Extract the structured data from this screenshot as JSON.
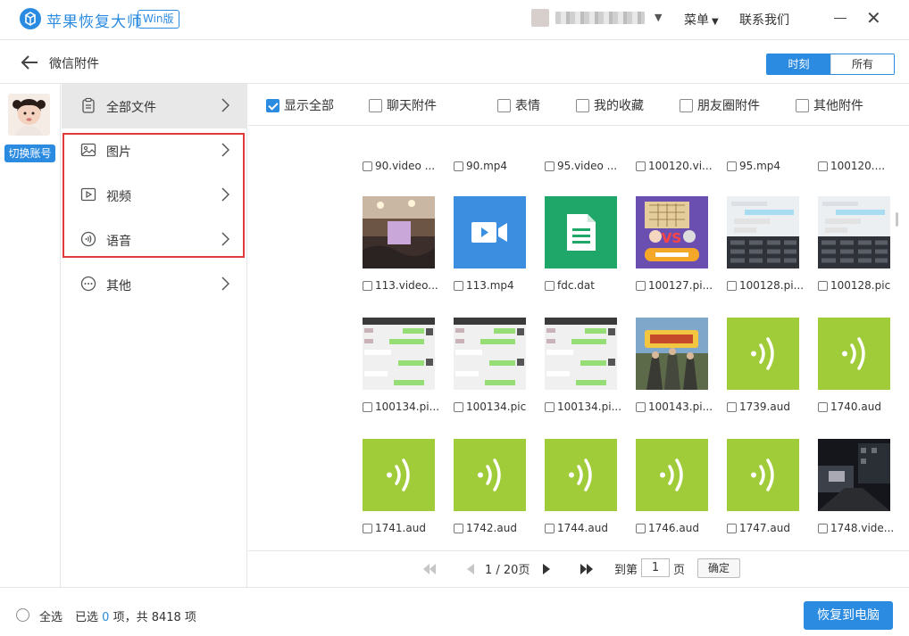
{
  "app": {
    "title": "苹果恢复大师",
    "badge": "Win版"
  },
  "header": {
    "menu_label": "菜单",
    "contact_label": "联系我们"
  },
  "page": {
    "title": "微信附件"
  },
  "view_toggle": {
    "options": [
      "时刻",
      "所有"
    ],
    "selected": "时刻"
  },
  "account": {
    "switch_label": "切换账号"
  },
  "categories": [
    {
      "label": "全部文件",
      "icon": "clipboard-icon",
      "active": true
    },
    {
      "label": "图片",
      "icon": "image-icon"
    },
    {
      "label": "视频",
      "icon": "video-icon"
    },
    {
      "label": "语音",
      "icon": "audio-icon"
    },
    {
      "label": "其他",
      "icon": "more-icon"
    }
  ],
  "filters": [
    {
      "label": "显示全部",
      "checked": true
    },
    {
      "label": "聊天附件",
      "checked": false
    },
    {
      "label": "表情",
      "checked": false
    },
    {
      "label": "我的收藏",
      "checked": false
    },
    {
      "label": "朋友圈附件",
      "checked": false
    },
    {
      "label": "其他附件",
      "checked": false
    }
  ],
  "files": {
    "row0": [
      "90.video ...",
      "90.mp4",
      "95.video ...",
      "100120.vi...",
      "95.mp4",
      "100120...."
    ],
    "row1": [
      "113.video...",
      "113.mp4",
      "fdc.dat",
      "100127.pi...",
      "100128.pi...",
      "100128.pic"
    ],
    "row2": [
      "100134.pi...",
      "100134.pic",
      "100134.pi...",
      "100143.pi...",
      "1739.aud",
      "1740.aud"
    ],
    "row3": [
      "1741.aud",
      "1742.aud",
      "1744.aud",
      "1746.aud",
      "1747.aud",
      "1748.vide..."
    ]
  },
  "pager": {
    "page_text": "1 / 20页",
    "goto_label": "到第",
    "page_unit": "页",
    "page_input": "1",
    "confirm": "确定"
  },
  "footer": {
    "select_all": "全选",
    "selected_prefix": "已选",
    "selected_count": "0",
    "selected_suffix": "项，共 8418 项",
    "recover_button": "恢复到电脑"
  },
  "colors": {
    "accent": "#2b8be0",
    "audio_tile": "#a0cc3a",
    "video_tile": "#3c8ee0",
    "doc_tile": "#1fa769",
    "highlight_box": "#e03a3a"
  }
}
